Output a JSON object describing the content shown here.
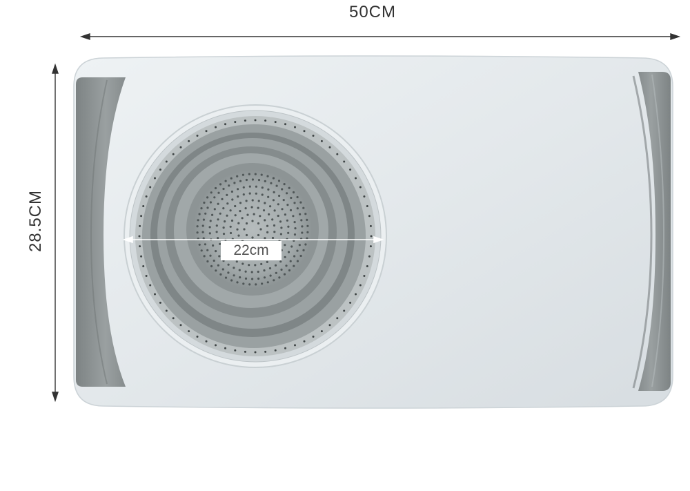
{
  "dimensions": {
    "width_label": "50CM",
    "height_label": "28.5CM",
    "colander_diameter_label": "22cm"
  },
  "colors": {
    "board": "#e4e9ec",
    "handle": "#8e9495",
    "colander_silicone": "#8b9293",
    "colander_inner": "#a9b0b1",
    "dimension_line": "#333333"
  }
}
